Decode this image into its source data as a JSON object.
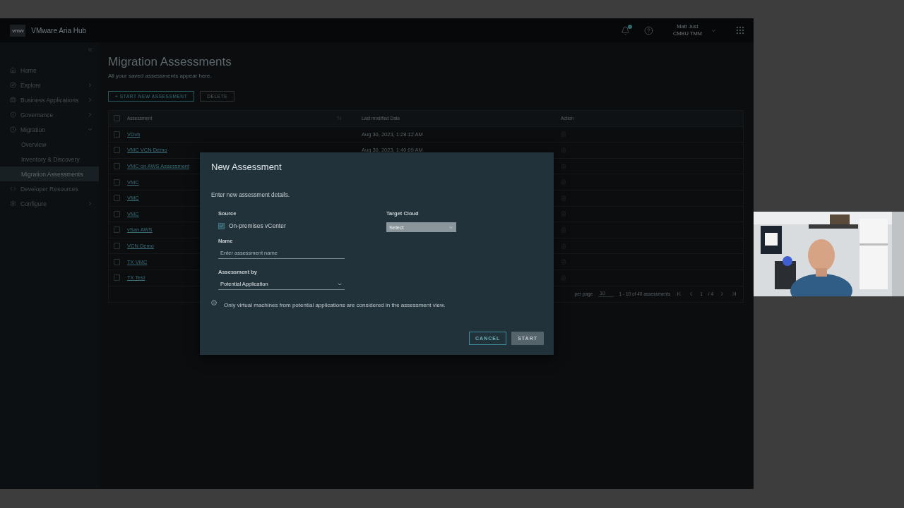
{
  "header": {
    "logo": "vmw",
    "product": "VMware Aria Hub",
    "notifications_unread": true,
    "user": {
      "name": "Matt Just",
      "role": "CMBU TMM"
    }
  },
  "sidebar": {
    "items": [
      {
        "label": "Home",
        "selected": false
      },
      {
        "label": "Explore",
        "selected": false,
        "expanded": false
      },
      {
        "label": "Business Applications",
        "selected": false,
        "expanded": false
      },
      {
        "label": "Governance",
        "selected": false,
        "expanded": false
      },
      {
        "label": "Migration",
        "selected": false,
        "expanded": true,
        "children": [
          {
            "label": "Overview",
            "selected": false
          },
          {
            "label": "Inventory & Discovery",
            "selected": false
          },
          {
            "label": "Migration Assessments",
            "selected": true
          }
        ]
      },
      {
        "label": "Developer Resources",
        "selected": false
      },
      {
        "label": "Configure",
        "selected": false,
        "expanded": false
      }
    ]
  },
  "page": {
    "title": "Migration Assessments",
    "subtitle": "All your saved assessments appear here.",
    "actions": [
      {
        "label": "+ START NEW ASSESSMENT",
        "disabled": false
      },
      {
        "label": "DELETE",
        "disabled": true
      }
    ]
  },
  "table": {
    "all_selected": false,
    "columns": [
      "Assessment",
      "Last modified Date",
      "Action"
    ],
    "rows": [
      {
        "name": "VDvb",
        "date": "Aug 30, 2023, 1:28:12 AM",
        "selected": false
      },
      {
        "name": "VMC VCN Demo",
        "date": "Aug 30, 2023, 1:40:09 AM",
        "selected": false
      },
      {
        "name": "VMC on AWS Assessment",
        "selected": false
      },
      {
        "name": "VMC",
        "selected": false
      },
      {
        "name": "VMC",
        "selected": false
      },
      {
        "name": "VMC",
        "selected": false
      },
      {
        "name": "vSan AWS",
        "selected": false
      },
      {
        "name": "VCN Demo",
        "selected": false
      },
      {
        "name": "TX VMC",
        "selected": false
      },
      {
        "name": "TX Test",
        "selected": false
      }
    ],
    "pagination": {
      "per_page_label": "per page",
      "per_page": "10",
      "range": "1 - 10 of 40 assessments",
      "page": "1",
      "page_total": "/ 4"
    }
  },
  "dialog": {
    "title": "New Assessment",
    "description": "Enter new assessment details.",
    "source": {
      "label": "Source",
      "option": "On-premises vCenter",
      "checked": true
    },
    "target": {
      "label": "Target Cloud",
      "value": "Select"
    },
    "name": {
      "label": "Name",
      "placeholder": "Enter assessment name"
    },
    "assessment_by": {
      "label": "Assessment by",
      "value": "Potential Application"
    },
    "note": "Only virtual machines from potential applications are considered in the assessment view.",
    "buttons": [
      {
        "label": "CANCEL",
        "kind": "secondary",
        "disabled": false
      },
      {
        "label": "START",
        "kind": "primary",
        "disabled": true
      }
    ]
  }
}
